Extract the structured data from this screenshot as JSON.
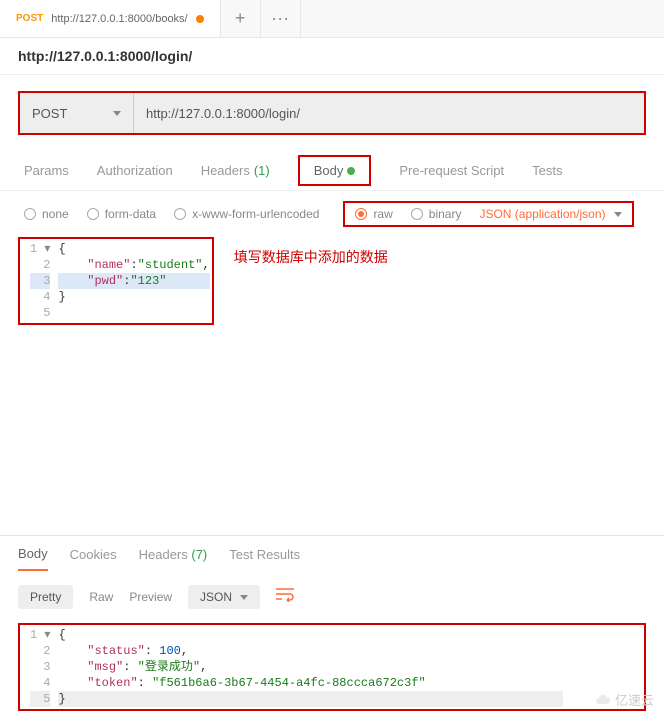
{
  "tab": {
    "method": "POST",
    "url": "http://127.0.0.1:8000/books/"
  },
  "tab_plus": "+",
  "tab_more": "···",
  "url_display": "http://127.0.0.1:8000/login/",
  "method_row": {
    "method": "POST",
    "url": "http://127.0.0.1:8000/login/"
  },
  "request_tabs": {
    "params": "Params",
    "authorization": "Authorization",
    "headers": "Headers",
    "headers_count": "(1)",
    "body": "Body",
    "prerequest": "Pre-request Script",
    "tests": "Tests"
  },
  "body_types": {
    "none": "none",
    "formdata": "form-data",
    "urlencoded": "x-www-form-urlencoded",
    "raw": "raw",
    "binary": "binary",
    "json_type": "JSON (application/json)"
  },
  "request_body": {
    "l1_open": "{",
    "l2_key": "\"name\"",
    "l2_val": "\"student\"",
    "l2_colon": ":",
    "l2_comma": ",",
    "l3_key": "\"pwd\"",
    "l3_val": "\"123\"",
    "l3_colon": ":",
    "l4_close": "}",
    "nums": {
      "n1": "1",
      "n2": "2",
      "n3": "3",
      "n4": "4",
      "n5": "5"
    }
  },
  "annotation_text": "填写数据库中添加的数据",
  "response_tabs": {
    "body": "Body",
    "cookies": "Cookies",
    "headers": "Headers",
    "headers_count": "(7)",
    "test_results": "Test Results"
  },
  "view_modes": {
    "pretty": "Pretty",
    "raw": "Raw",
    "preview": "Preview",
    "json": "JSON"
  },
  "response_body": {
    "l1_open": "{",
    "l2_key": "\"status\"",
    "l2_val": "100",
    "l2_comma": ",",
    "l3_key": "\"msg\"",
    "l3_val": "\"登录成功\"",
    "l3_comma": ",",
    "l4_key": "\"token\"",
    "l4_val": "\"f561b6a6-3b67-4454-a4fc-88ccca672c3f\"",
    "l5_close": "}",
    "nums": {
      "n1": "1",
      "n2": "2",
      "n3": "3",
      "n4": "4",
      "n5": "5"
    }
  },
  "watermark": "亿速云"
}
